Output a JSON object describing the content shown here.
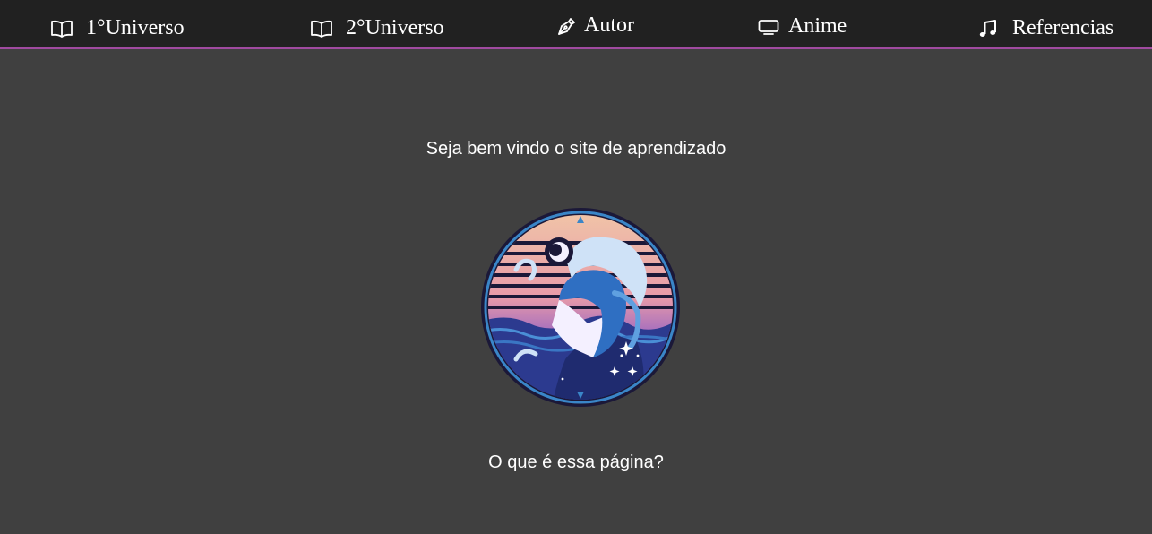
{
  "nav": {
    "items": [
      {
        "label": "1°Universo",
        "icon": "book-icon"
      },
      {
        "label": "2°Universo",
        "icon": "book-icon"
      },
      {
        "label": "Autor",
        "icon": "pen-icon"
      },
      {
        "label": "Anime",
        "icon": "tv-icon"
      },
      {
        "label": "Referencias",
        "icon": "music-icon"
      }
    ],
    "accent_color": "#a04aa0"
  },
  "main": {
    "welcome_text": "Seja bem vindo o site de aprendizado",
    "logo": "jojo-portrait-emblem",
    "question_text": "O que é essa página?"
  },
  "colors": {
    "nav_background": "#212121",
    "page_background": "#404040"
  }
}
